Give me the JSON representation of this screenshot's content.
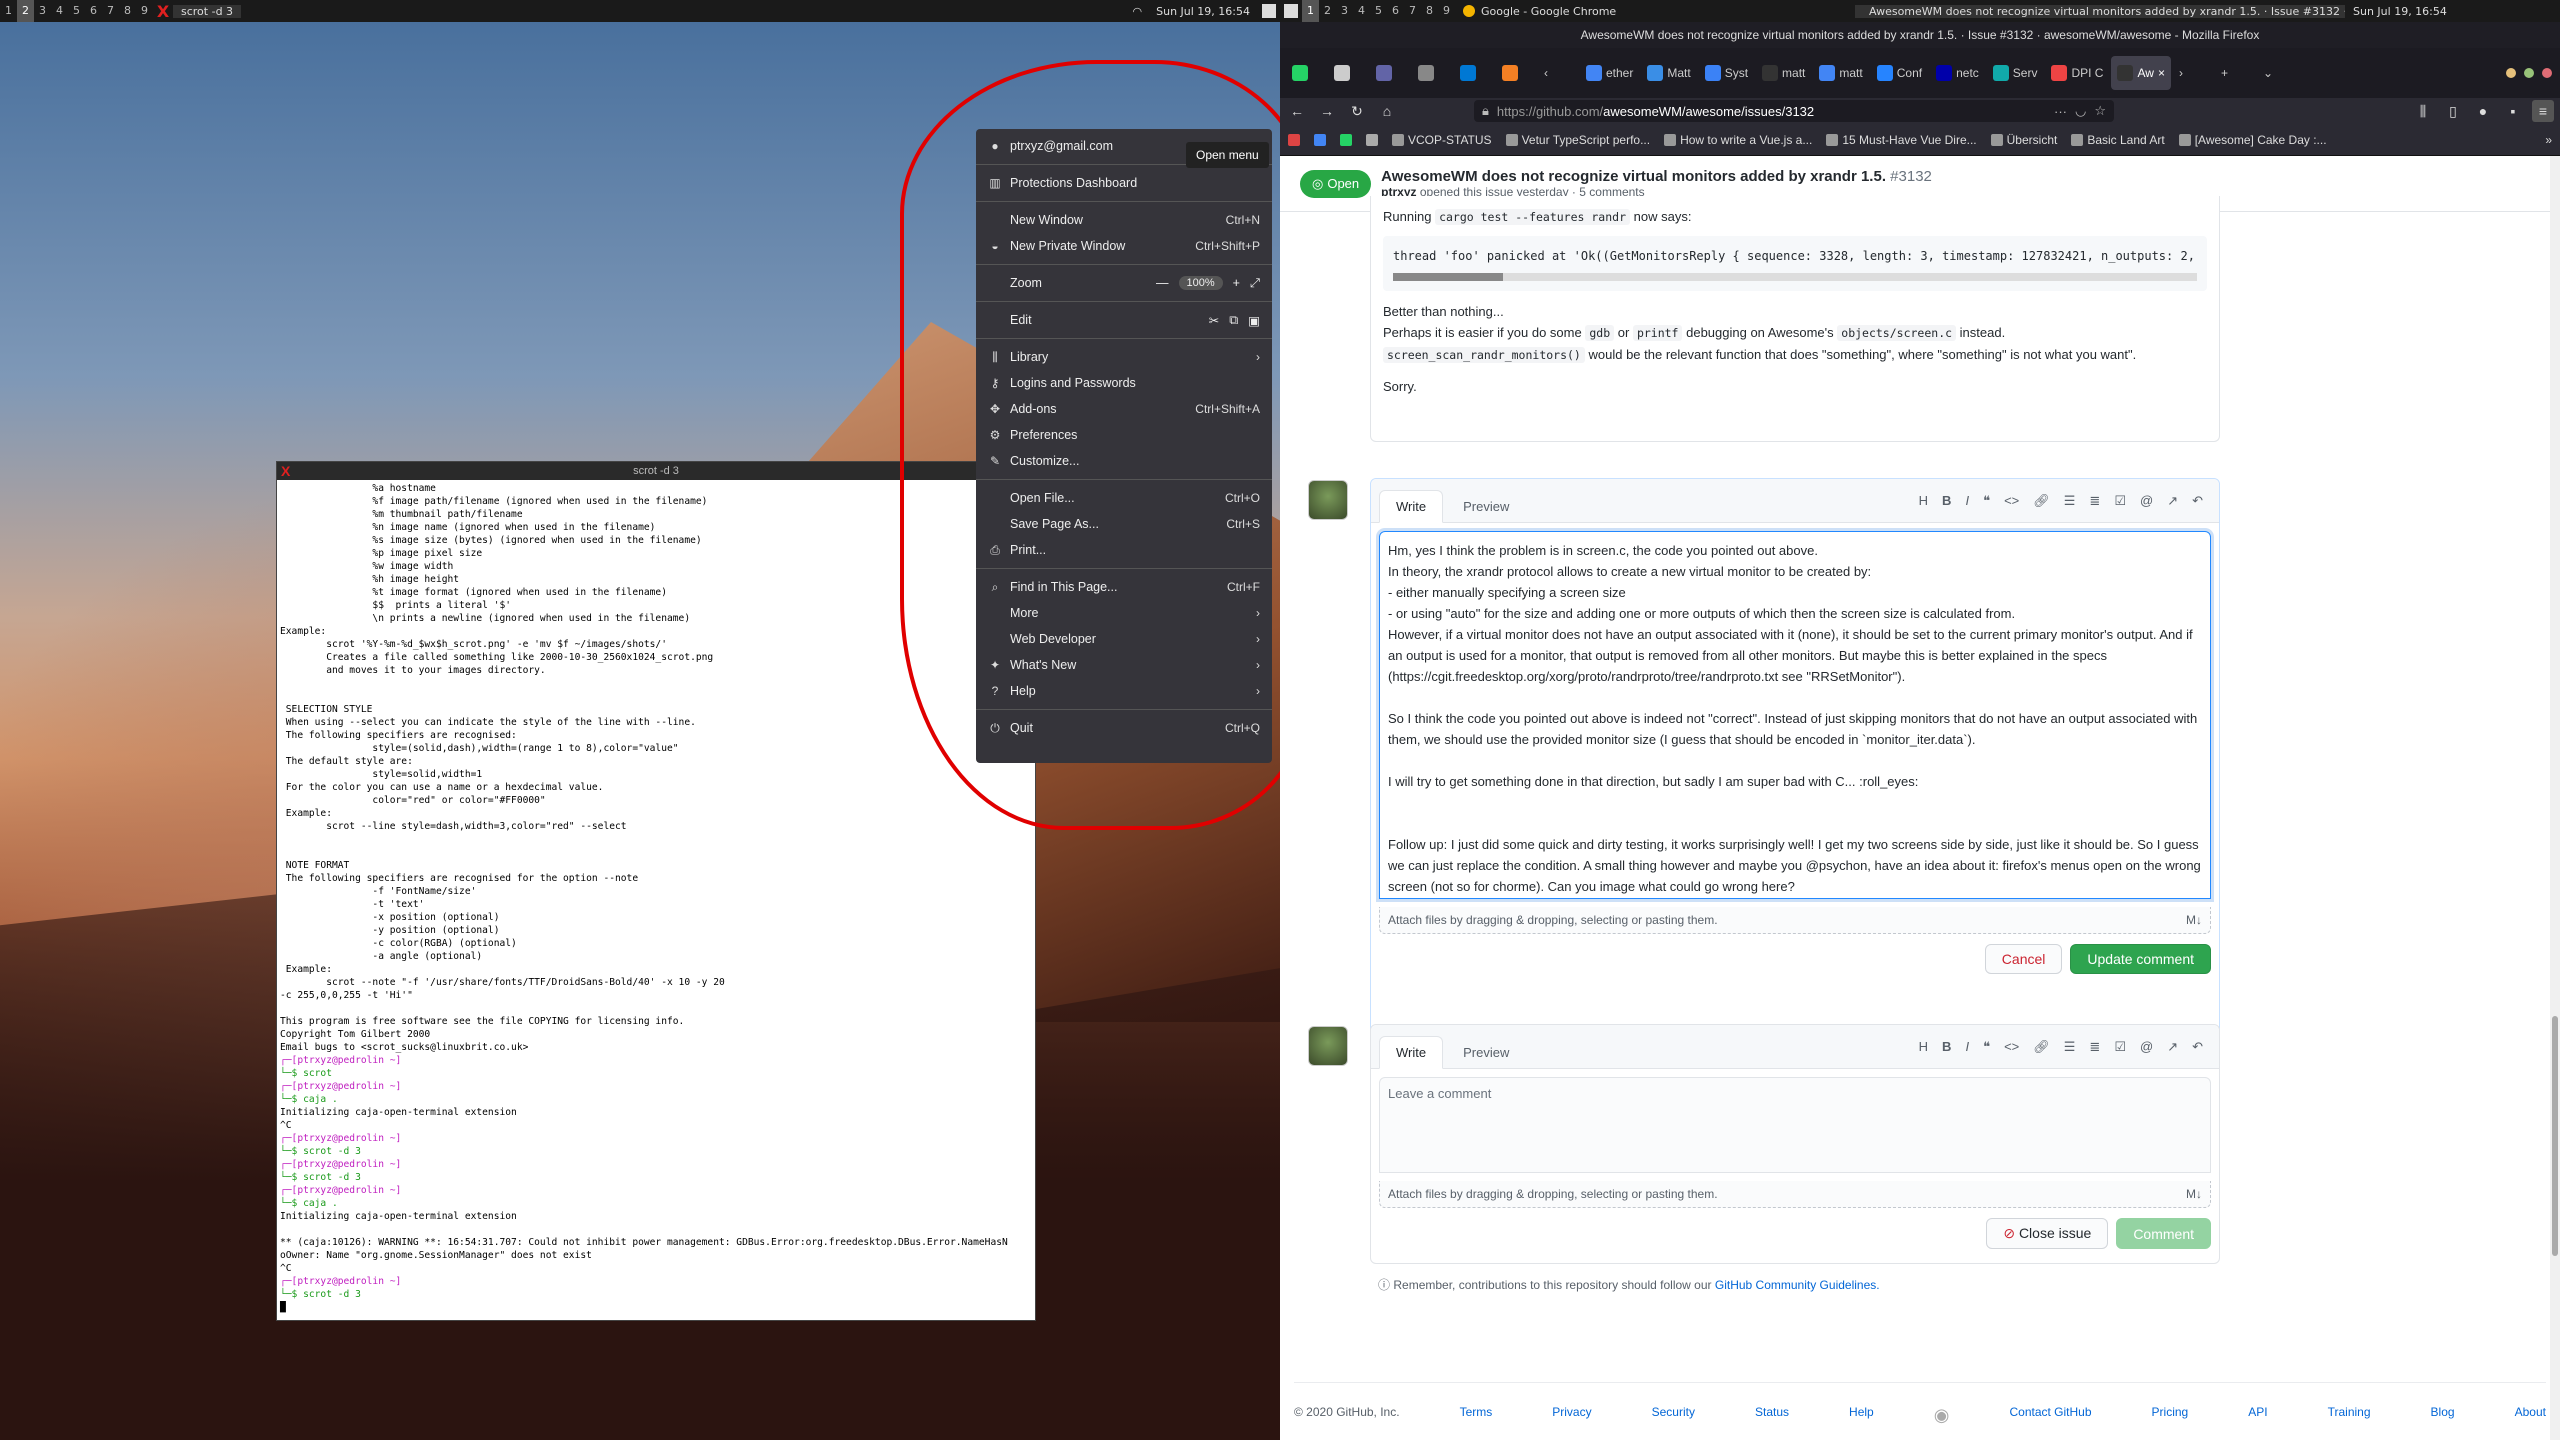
{
  "left_bar": {
    "tags": [
      "1",
      "2",
      "3",
      "4",
      "5",
      "6",
      "7",
      "8",
      "9"
    ],
    "active_tag": "2",
    "window_title": "scrot -d 3",
    "clock": "Sun Jul 19, 16:54"
  },
  "right_bar": {
    "tags": [
      "1",
      "2",
      "3",
      "4",
      "5",
      "6",
      "7",
      "8",
      "9"
    ],
    "window1": "Google - Google Chrome",
    "window2": "AwesomeWM does not recognize virtual monitors added by xrandr 1.5. · Issue #3132 · awesome...",
    "clock": "Sun Jul 19, 16:54"
  },
  "terminal": {
    "title": "scrot -d 3",
    "lines": [
      "                %a hostname",
      "                %f image path/filename (ignored when used in the filename)",
      "                %m thumbnail path/filename",
      "                %n image name (ignored when used in the filename)",
      "                %s image size (bytes) (ignored when used in the filename)",
      "                %p image pixel size",
      "                %w image width",
      "                %h image height",
      "                %t image format (ignored when used in the filename)",
      "                $$  prints a literal '$'",
      "                \\n prints a newline (ignored when used in the filename)",
      "Example:",
      "        scrot '%Y-%m-%d_$wx$h_scrot.png' -e 'mv $f ~/images/shots/'",
      "        Creates a file called something like 2000-10-30_2560x1024_scrot.png",
      "        and moves it to your images directory.",
      "",
      "",
      " SELECTION STYLE",
      " When using --select you can indicate the style of the line with --line.",
      " The following specifiers are recognised:",
      "                style=(solid,dash),width=(range 1 to 8),color=\"value\"",
      " The default style are:",
      "                style=solid,width=1",
      " For the color you can use a name or a hexdecimal value.",
      "                color=\"red\" or color=\"#FF0000\"",
      " Example:",
      "        scrot --line style=dash,width=3,color=\"red\" --select",
      "",
      "",
      " NOTE FORMAT",
      " The following specifiers are recognised for the option --note",
      "                -f 'FontName/size'",
      "                -t 'text'",
      "                -x position (optional)",
      "                -y position (optional)",
      "                -c color(RGBA) (optional)",
      "                -a angle (optional)",
      " Example:",
      "        scrot --note \"-f '/usr/share/fonts/TTF/DroidSans-Bold/40' -x 10 -y 20",
      "-c 255,0,0,255 -t 'Hi'\"",
      "",
      "This program is free software see the file COPYING for licensing info.",
      "Copyright Tom Gilbert 2000",
      "Email bugs to <scrot_sucks@linuxbrit.co.uk>"
    ],
    "session": [
      {
        "p": "┌─[ptrxyz@pedrolin ~]",
        "c": "└─$ scrot"
      },
      {
        "p": "┌─[ptrxyz@pedrolin ~]",
        "c": "└─$ caja ."
      },
      {
        "out": "Initializing caja-open-terminal extension"
      },
      {
        "out": "^C"
      },
      {
        "p": "┌─[ptrxyz@pedrolin ~]",
        "c": "└─$ scrot -d 3"
      },
      {
        "p": "┌─[ptrxyz@pedrolin ~]",
        "c": "└─$ scrot -d 3"
      },
      {
        "p": "┌─[ptrxyz@pedrolin ~]",
        "c": "└─$ caja ."
      },
      {
        "out": "Initializing caja-open-terminal extension"
      },
      {
        "out": ""
      },
      {
        "out": "** (caja:10126): WARNING **: 16:54:31.707: Could not inhibit power management: GDBus.Error:org.freedesktop.DBus.Error.NameHasN"
      },
      {
        "out": "oOwner: Name \"org.gnome.SessionManager\" does not exist"
      },
      {
        "out": "^C"
      },
      {
        "p": "┌─[ptrxyz@pedrolin ~]",
        "c": "└─$ scrot -d 3"
      }
    ]
  },
  "ffmenu": {
    "account": "ptrxyz@gmail.com",
    "tooltip": "Open menu",
    "items": [
      {
        "label": "Protections Dashboard"
      },
      {
        "label": "New Window",
        "shortcut": "Ctrl+N"
      },
      {
        "label": "New Private Window",
        "shortcut": "Ctrl+Shift+P"
      },
      {
        "label": "Zoom",
        "zoom": "100%"
      },
      {
        "label": "Edit"
      },
      {
        "label": "Library"
      },
      {
        "label": "Logins and Passwords"
      },
      {
        "label": "Add-ons",
        "shortcut": "Ctrl+Shift+A"
      },
      {
        "label": "Preferences"
      },
      {
        "label": "Customize..."
      },
      {
        "label": "Open File...",
        "shortcut": "Ctrl+O"
      },
      {
        "label": "Save Page As...",
        "shortcut": "Ctrl+S"
      },
      {
        "label": "Print..."
      },
      {
        "label": "Find in This Page...",
        "shortcut": "Ctrl+F"
      },
      {
        "label": "More"
      },
      {
        "label": "Web Developer"
      },
      {
        "label": "What's New"
      },
      {
        "label": "Help"
      },
      {
        "label": "Quit",
        "shortcut": "Ctrl+Q"
      }
    ]
  },
  "firefox": {
    "title": "AwesomeWM does not recognize virtual monitors added by xrandr 1.5. · Issue #3132 · awesomeWM/awesome - Mozilla Firefox",
    "tabs": [
      "ether",
      "Matt",
      "Syst",
      "matt",
      "matt",
      "Conf",
      "netc",
      "Serv",
      "DPI C",
      "Aw"
    ],
    "url_prefix": "https://github.com/",
    "url_path": "awesomeWM/awesome/issues/3132",
    "bookmarks": [
      "VCOP-STATUS",
      "Vetur TypeScript perfo...",
      "How to write a Vue.js a...",
      "15 Must-Have Vue Dire...",
      "Übersicht",
      "Basic Land Art",
      "[Awesome] Cake Day :..."
    ]
  },
  "issue": {
    "state": "Open",
    "title": "AwesomeWM does not recognize virtual monitors added by xrandr 1.5.",
    "number": "#3132",
    "author": "ptrxyz",
    "meta": "opened this issue yesterday · 5 comments"
  },
  "comment": {
    "running": "Running",
    "cmd": "cargo test --features randr",
    "now_says": "now says:",
    "code": "thread 'foo' panicked at 'Ok((GetMonitorsReply { sequence: 3328, length: 3, timestamp: 127832421, n_outputs: 2,",
    "p1": "Better than nothing...",
    "p2a": "Perhaps it is easier if you do some",
    "gdb": "gdb",
    "or": "or",
    "printf": "printf",
    "p2b": "debugging on Awesome's",
    "file": "objects/screen.c",
    "p2c": "instead.",
    "fn": "screen_scan_randr_monitors()",
    "p3": "would be the relevant function that does \"something\", where \"something\" is not what you want\".",
    "p4": "Sorry."
  },
  "editor": {
    "tab_write": "Write",
    "tab_preview": "Preview",
    "text": "Hm, yes I think the problem is in screen.c, the code you pointed out above.\nIn theory, the xrandr protocol allows to create a new virtual monitor to be created by:\n- either manually specifying a screen size\n- or using \"auto\" for the size and adding one or more outputs of which then the screen size is calculated from.\nHowever, if a virtual monitor does not have an output associated with it (none), it should be set to the current primary monitor's output. And if an output is used for a monitor, that output is removed from all other monitors. But maybe this is better explained in the specs (https://cgit.freedesktop.org/xorg/proto/randrproto/tree/randrproto.txt see \"RRSetMonitor\").\n\nSo I think the code you pointed out above is indeed not \"correct\". Instead of just skipping monitors that do not have an output associated with them, we should use the provided monitor size (I guess that should be encoded in `monitor_iter.data`).\n\nI will try to get something done in that direction, but sadly I am super bad with C... :roll_eyes:\n\n\nFollow up: I just did some quick and dirty testing, it works surprisingly well! I get my two screens side by side, just like it should be. So I guess we can just replace the condition. A small thing however and maybe you @psychon, have an idea about it: firefox's menus open on the wrong screen (not so for chorme). Can you image what could go wrong here?",
    "attach": "Attach files by dragging & dropping, selecting or pasting them.",
    "cancel": "Cancel",
    "update": "Update comment"
  },
  "new_comment": {
    "tab_write": "Write",
    "tab_preview": "Preview",
    "placeholder": "Leave a comment",
    "attach": "Attach files by dragging & dropping, selecting or pasting them.",
    "close": "Close issue",
    "comment": "Comment"
  },
  "note": {
    "text": "Remember, contributions to this repository should follow our",
    "link": "GitHub Community Guidelines."
  },
  "footer": {
    "copyright": "© 2020 GitHub, Inc.",
    "links": [
      "Terms",
      "Privacy",
      "Security",
      "Status",
      "Help",
      "Contact GitHub",
      "Pricing",
      "API",
      "Training",
      "Blog",
      "About"
    ]
  }
}
